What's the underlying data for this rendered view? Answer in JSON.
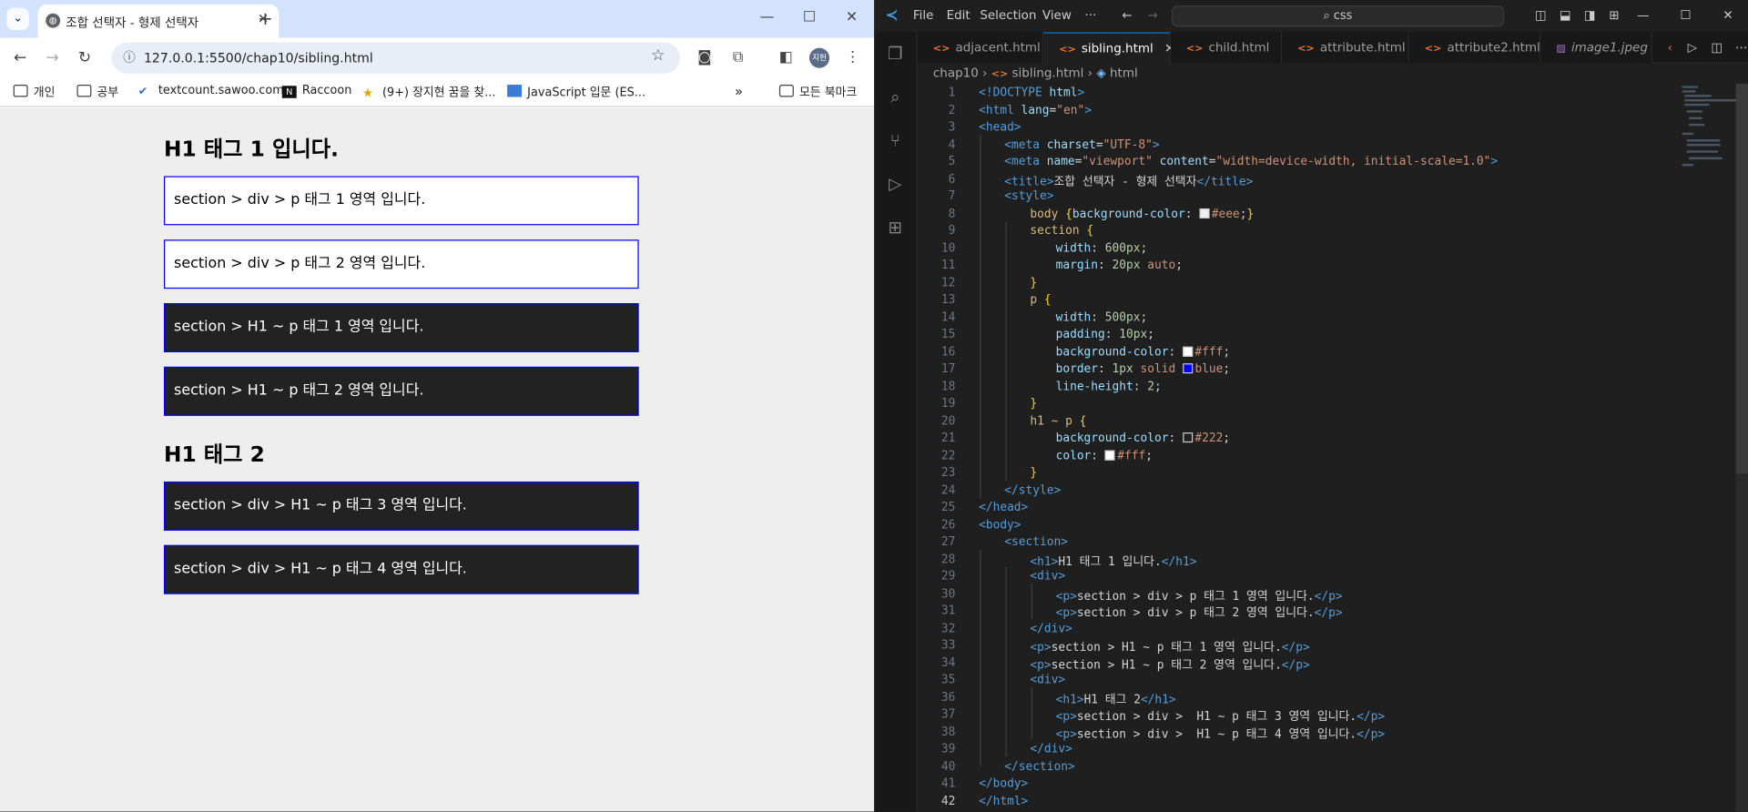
{
  "browser": {
    "tab_title": "조합 선택자 - 형제 선택자",
    "url": "127.0.0.1:5500/chap10/sibling.html",
    "avatar": "지헌",
    "bookmarks": [
      "개인",
      "공부",
      "textcount.sawoo.com",
      "Raccoon",
      "(9+) 장지현 꿈을 찾...",
      "JavaScript 입문 (ES...",
      "모든 북마크"
    ],
    "content": {
      "h1_first": "H1 태그 1 입니다.",
      "p1": "section > div > p 태그 1 영역 입니다.",
      "p2": "section > div > p 태그 2 영역 입니다.",
      "p3": "section > H1 ~ p 태그 1 영역 입니다.",
      "p4": "section > H1 ~ p 태그 2 영역 입니다.",
      "h1_second": "H1 태그 2",
      "p5": "section > div > H1 ~ p 태그 3 영역 입니다.",
      "p6": "section > div > H1 ~ p 태그 4 영역 입니다."
    }
  },
  "vscode": {
    "menu": [
      "File",
      "Edit",
      "Selection",
      "View",
      "···"
    ],
    "search": "css",
    "tabs": [
      "adjacent.html",
      "sibling.html",
      "child.html",
      "attribute.html",
      "attribute2.html",
      "image1.jpeg"
    ],
    "active_tab": "sibling.html",
    "breadcrumb": [
      "chap10",
      "sibling.html",
      "html"
    ],
    "code": {
      "l1a": "<!DOCTYPE",
      "l1b": " html",
      "l1c": ">",
      "l2": "<html",
      "l2a": " lang",
      "l2b": "=",
      "l2c": "\"en\"",
      "l2d": ">",
      "l3": "<head>",
      "l4a": "<meta",
      "l4b": " charset",
      "l4c": "=",
      "l4d": "\"UTF-8\"",
      "l4e": ">",
      "l5a": "<meta",
      "l5b": " name",
      "l5c": "=",
      "l5d": "\"viewport\"",
      "l5e": " content",
      "l5f": "=",
      "l5g": "\"width=device-width, initial-scale=1.0\"",
      "l5h": ">",
      "l6a": "<title>",
      "l6b": "조합 선택자 - 형제 선택자",
      "l6c": "</title>",
      "l7": "<style>",
      "l8a": "body ",
      "l8b": "{",
      "l8c": "background-color",
      "l8d": ": ",
      "l8e": "#eee",
      "l8f": ";",
      "l8g": "}",
      "l9a": "section ",
      "l9b": "{",
      "l10a": "width",
      "l10b": ": ",
      "l10c": "600px",
      "l10d": ";",
      "l11a": "margin",
      "l11b": ": ",
      "l11c": "20px",
      "l11d": " auto",
      "l11e": ";",
      "l12": "}",
      "l13a": "p ",
      "l13b": "{",
      "l14a": "width",
      "l14b": ": ",
      "l14c": "500px",
      "l14d": ";",
      "l15a": "padding",
      "l15b": ": ",
      "l15c": "10px",
      "l15d": ";",
      "l16a": "background-color",
      "l16b": ": ",
      "l16c": "#fff",
      "l16d": ";",
      "l17a": "border",
      "l17b": ": ",
      "l17c": "1px",
      "l17d": " solid ",
      "l17e": "blue",
      "l17f": ";",
      "l18a": "line-height",
      "l18b": ": ",
      "l18c": "2",
      "l18d": ";",
      "l19": "}",
      "l20a": "h1 ~ p ",
      "l20b": "{",
      "l21a": "background-color",
      "l21b": ": ",
      "l21c": "#222",
      "l21d": ";",
      "l22a": "color",
      "l22b": ": ",
      "l22c": "#fff",
      "l22d": ";",
      "l23": "}",
      "l24": "</style>",
      "l25": "</head>",
      "l26": "<body>",
      "l27": "<section>",
      "l28a": "<h1>",
      "l28b": "H1 태그 1 입니다.",
      "l28c": "</h1>",
      "l29": "<div>",
      "l30a": "<p>",
      "l30b": "section > div > p 태그 1 영역 입니다.",
      "l30c": "</p>",
      "l31a": "<p>",
      "l31b": "section > div > p 태그 2 영역 입니다.",
      "l31c": "</p>",
      "l32": "</div>",
      "l33a": "<p>",
      "l33b": "section > H1 ~ p 태그 1 영역 입니다.",
      "l33c": "</p>",
      "l34a": "<p>",
      "l34b": "section > H1 ~ p 태그 2 영역 입니다.",
      "l34c": "</p>",
      "l35": "<div>",
      "l36a": "<h1>",
      "l36b": "H1 태그 2",
      "l36c": "</h1>",
      "l37a": "<p>",
      "l37b": "section > div >  H1 ~ p 태그 3 영역 입니다.",
      "l37c": "</p>",
      "l38a": "<p>",
      "l38b": "section > div >  H1 ~ p 태그 4 영역 입니다.",
      "l38c": "</p>",
      "l39": "</div>",
      "l40": "</section>",
      "l41": "</body>",
      "l42": "</html>"
    },
    "line_numbers": [
      "1",
      "2",
      "3",
      "4",
      "5",
      "6",
      "7",
      "8",
      "9",
      "10",
      "11",
      "12",
      "13",
      "14",
      "15",
      "16",
      "17",
      "18",
      "19",
      "20",
      "21",
      "22",
      "23",
      "24",
      "25",
      "26",
      "27",
      "28",
      "29",
      "30",
      "31",
      "32",
      "33",
      "34",
      "35",
      "36",
      "37",
      "38",
      "39",
      "40",
      "41",
      "42"
    ]
  },
  "colors": {
    "swatch_eee": "#eeeeee",
    "swatch_fff": "#ffffff",
    "swatch_blue": "#0000ff",
    "swatch_222": "#222222",
    "accent": "#0078d4"
  }
}
